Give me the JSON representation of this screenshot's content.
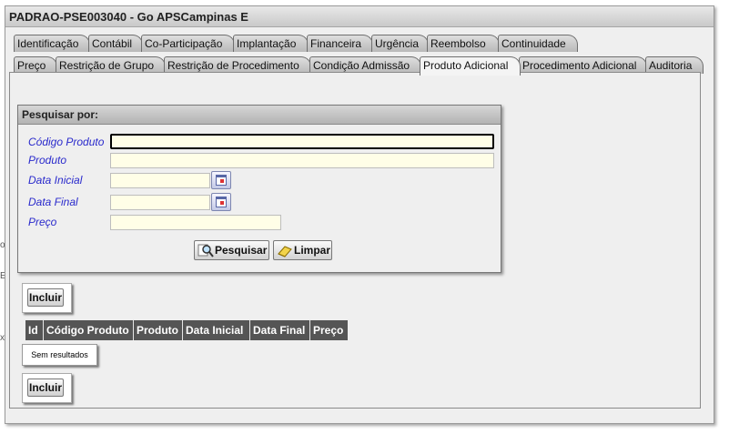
{
  "window": {
    "title": "PADRAO-PSE003040 - Go APSCampinas E"
  },
  "edge_glyphs": [
    "o",
    "E",
    "x"
  ],
  "tabs_row1": [
    "Identificação",
    "Contábil",
    "Co-Participação",
    "Implantação",
    "Financeira",
    "Urgência",
    "Reembolso",
    "Continuidade"
  ],
  "tabs_row2": [
    "Preço",
    "Restrição de Grupo",
    "Restrição de Procedimento",
    "Condição Admissão",
    "Produto Adicional",
    "Procedimento Adicional",
    "Auditoria"
  ],
  "active_tab": "Produto Adicional",
  "search": {
    "title": "Pesquisar por:",
    "fields": {
      "codigo_produto": {
        "label": "Código Produto",
        "value": ""
      },
      "produto": {
        "label": "Produto",
        "value": ""
      },
      "data_inicial": {
        "label": "Data Inicial",
        "value": ""
      },
      "data_final": {
        "label": "Data Final",
        "value": ""
      },
      "preco": {
        "label": "Preço",
        "value": ""
      }
    },
    "search_button": "Pesquisar",
    "clear_button": "Limpar"
  },
  "include_button": "Incluir",
  "table": {
    "columns": [
      "Id",
      "Código Produto",
      "Produto",
      "Data Inicial",
      "Data Final",
      "Preço"
    ],
    "empty_text": "Sem resultados"
  },
  "colors": {
    "field_background": "#fffee7",
    "label_color": "#2a2acc",
    "table_header": "#555555"
  }
}
